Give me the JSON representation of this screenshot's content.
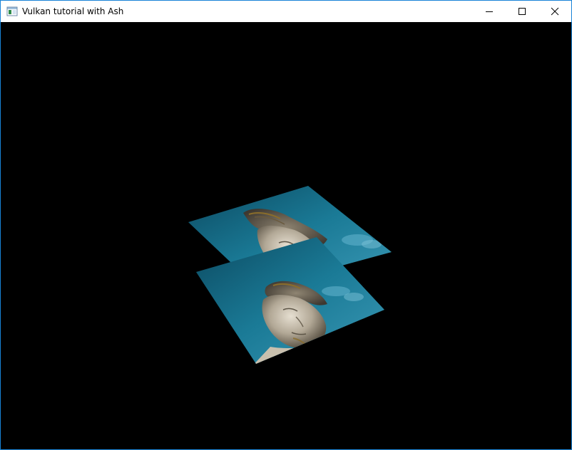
{
  "window": {
    "title": "Vulkan tutorial with Ash",
    "accent_color": "#1883d7",
    "controls": [
      {
        "name": "minimize",
        "icon": "minimize-icon"
      },
      {
        "name": "maximize",
        "icon": "maximize-icon"
      },
      {
        "name": "close",
        "icon": "close-icon"
      }
    ]
  },
  "viewport": {
    "background_color": "#000000",
    "scene": "two textured quads with statue image",
    "texture_colors": {
      "sky_dark": "#0c4a61",
      "sky_mid": "#1a7a96",
      "sky_light": "#3a98b5",
      "stone_light": "#d9d2c3",
      "stone_mid": "#a39a88",
      "stone_dark": "#5d5547",
      "moss": "#8a6d2b"
    }
  }
}
